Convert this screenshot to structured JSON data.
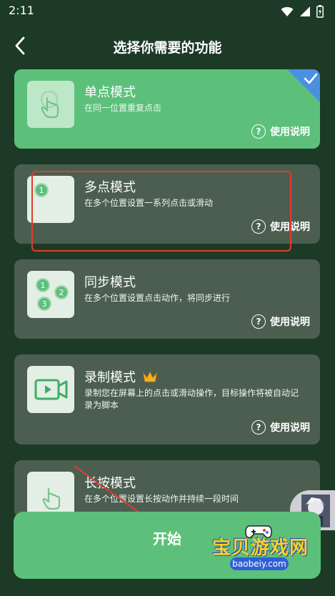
{
  "status_bar": {
    "time": "2:11"
  },
  "header": {
    "title": "选择你需要的功能"
  },
  "modes": [
    {
      "name": "单点模式",
      "desc": "在同一位置重复点击",
      "help": "使用说明",
      "selected": true
    },
    {
      "name": "多点模式",
      "desc": "在多个位置设置一系列点击或滑动",
      "help": "使用说明",
      "badge": "1"
    },
    {
      "name": "同步模式",
      "desc": "在多个位置设置点击动作，将同步进行",
      "help": "使用说明",
      "badges": [
        "1",
        "2",
        "3"
      ]
    },
    {
      "name": "录制模式",
      "desc": "录制您在屏幕上的点击或滑动操作，目标操作将被自动记录为脚本",
      "help": "使用说明"
    },
    {
      "name": "长按模式",
      "desc": "在多个位置设置长按动作并持续一段时间"
    }
  ],
  "start_button": {
    "label": "开始"
  },
  "watermark": {
    "text": "宝贝游戏网",
    "url": "baobeiy.com"
  },
  "colors": {
    "background": "#1d3a26",
    "card": "#4b5e50",
    "selected_card": "#5cc07b",
    "accent": "#5cc07b",
    "highlight": "#e23b2e"
  }
}
